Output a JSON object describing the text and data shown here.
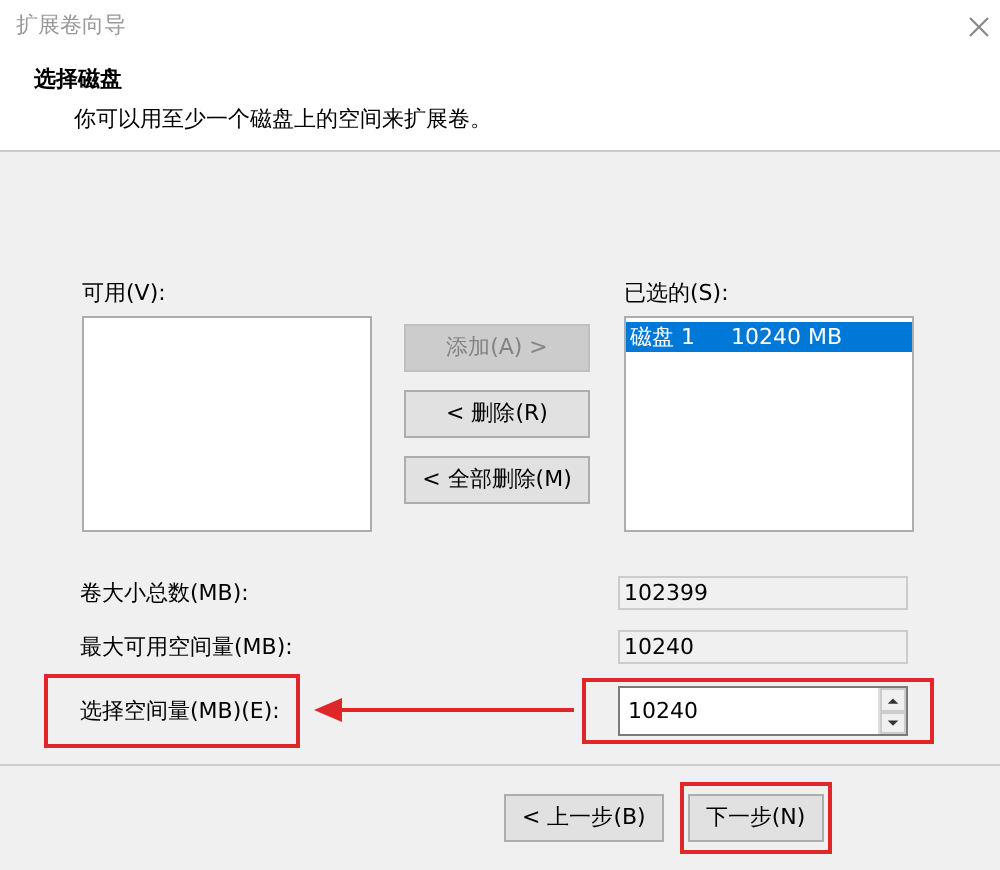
{
  "window": {
    "title": "扩展卷向导"
  },
  "header": {
    "title": "选择磁盘",
    "subtitle": "你可以用至少一个磁盘上的空间来扩展卷。"
  },
  "available": {
    "label": "可用(V):"
  },
  "move_buttons": [
    {
      "label": "添加(A) >",
      "disabled": true
    },
    {
      "label": "< 删除(R)",
      "disabled": false
    },
    {
      "label": "< 全部删除(M)",
      "disabled": false
    }
  ],
  "chosen": {
    "label": "已选的(S):",
    "items": [
      {
        "name": "磁盘 1",
        "size": "10240 MB",
        "selected": true
      }
    ]
  },
  "fields": [
    {
      "kind": "readonly",
      "label": "卷大小总数(MB):",
      "value": "102399",
      "highlighted": false
    },
    {
      "kind": "readonly",
      "label": "最大可用空间量(MB):",
      "value": "10240",
      "highlighted": false
    },
    {
      "kind": "spin",
      "label": "选择空间量(MB)(E):",
      "value": "10240",
      "highlighted": true
    }
  ],
  "footer_buttons": [
    {
      "label": "< 上一步(B)",
      "highlighted": false
    },
    {
      "label": "下一步(N)",
      "highlighted": true
    }
  ]
}
